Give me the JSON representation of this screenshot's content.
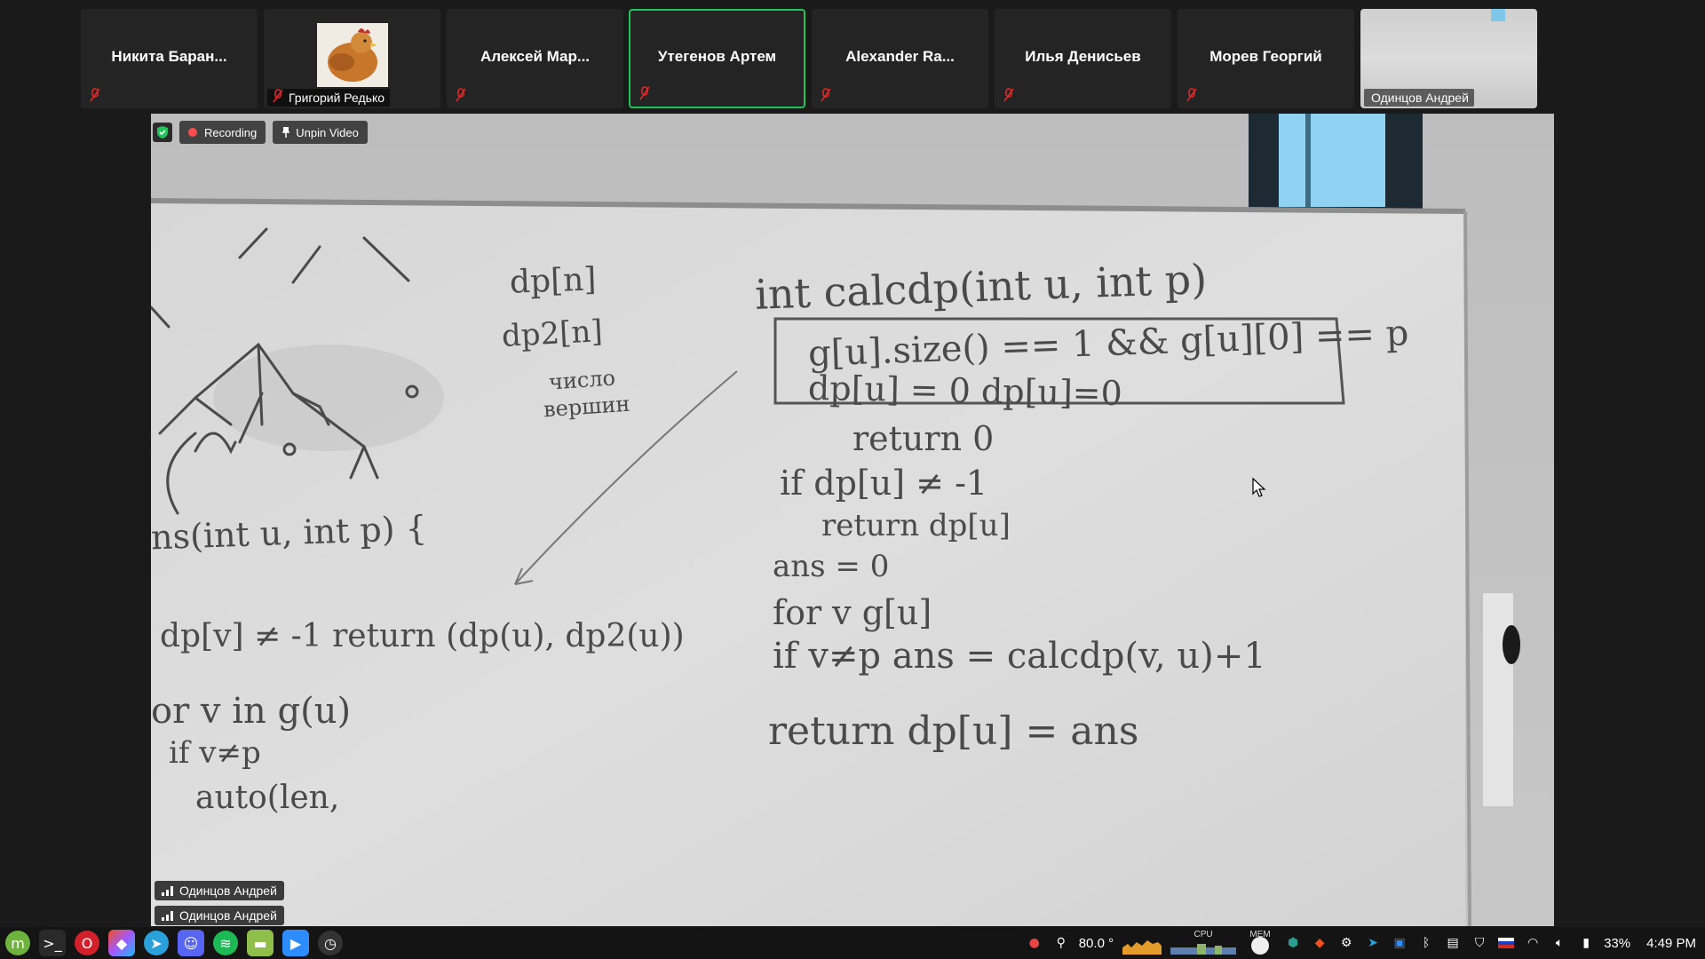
{
  "participants": [
    {
      "name": "Никита Баран...",
      "muted": true
    },
    {
      "name": "Григорий Редько",
      "muted": true,
      "avatar": "chicken-photo"
    },
    {
      "name": "Алексей Мар...",
      "muted": true
    },
    {
      "name": "Утегенов Артем",
      "muted": true,
      "speaking": true
    },
    {
      "name": "Alexander Ra...",
      "muted": true
    },
    {
      "name": "Илья Денисьев",
      "muted": true
    },
    {
      "name": "Морев Георгий",
      "muted": true
    },
    {
      "name": "Одинцов Андрей",
      "muted": false,
      "video": "whiteboard"
    }
  ],
  "video_toolbar": {
    "recording_label": "Recording",
    "unpin_label": "Unpin Video"
  },
  "name_tags": [
    "Одинцов Андрей",
    "Одинцов Андрей"
  ],
  "whiteboard_text": {
    "l1": "dp[n]",
    "l2": "dp2[n]",
    "l3": "число",
    "l4": "вершин",
    "l5": "int calcdp(int u, int p)",
    "l6": "g[u].size() == 1 && g[u][0] == p",
    "l7": "dp[u] = 0  dp[u]=0",
    "l8": "return 0",
    "l9": "if dp[u] ≠ -1",
    "l10": "return dp[u]",
    "l11": "ans = 0",
    "l12": "for v g[u]",
    "l13": "if v≠p  ans = calcdp(v, u)+1",
    "l14": "return dp[u] = ans",
    "l15": "ns(int u, int p) {",
    "l16": "dp[v] ≠ -1 return (dp(u), dp2(u))",
    "l17": "or v in g(u)",
    "l18": "if v≠p",
    "l19": "auto(len,"
  },
  "taskbar": {
    "apps": [
      "mint-menu-icon",
      "terminal-icon",
      "opera-icon",
      "figma-icon",
      "telegram-icon",
      "discord-icon",
      "spotify-icon",
      "files-icon",
      "zoom-icon",
      "timeshift-icon"
    ],
    "temperature": "80.0 °",
    "cpu_label": "CPU",
    "mem_label": "MEM",
    "battery": "33%",
    "time": "4:49 PM"
  },
  "colors": {
    "speaking_border": "#23c35a",
    "muted_red": "#e02828",
    "recording_dot": "#ff4d4d"
  }
}
